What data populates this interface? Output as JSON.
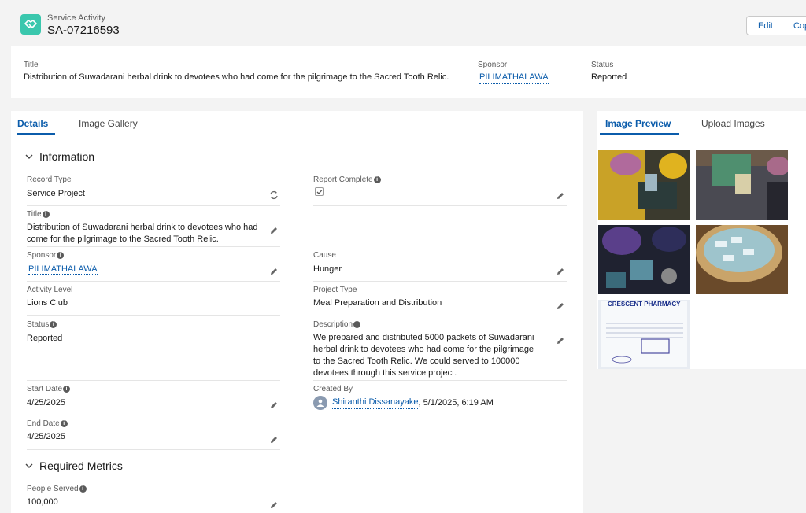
{
  "header": {
    "object_type": "Service Activity",
    "record_name": "SA-07216593",
    "buttons": {
      "edit": "Edit",
      "copy": "Cop"
    }
  },
  "highlights": {
    "title_label": "Title",
    "title_value": "Distribution of Suwadarani herbal drink to devotees who had come for the pilgrimage to the Sacred Tooth Relic.",
    "sponsor_label": "Sponsor",
    "sponsor_value": "PILIMATHALAWA",
    "status_label": "Status",
    "status_value": "Reported"
  },
  "tabs": {
    "details": "Details",
    "gallery": "Image Gallery"
  },
  "sections": {
    "information": "Information",
    "metrics": "Required Metrics"
  },
  "fields": {
    "record_type": {
      "label": "Record Type",
      "value": "Service Project"
    },
    "report_complete": {
      "label": "Report Complete",
      "checked": true
    },
    "title": {
      "label": "Title",
      "value": "Distribution of Suwadarani herbal drink to devotees who had come for the pilgrimage to the Sacred Tooth Relic."
    },
    "sponsor": {
      "label": "Sponsor",
      "value": "PILIMATHALAWA"
    },
    "cause": {
      "label": "Cause",
      "value": "Hunger"
    },
    "activity_level": {
      "label": "Activity Level",
      "value": "Lions Club"
    },
    "project_type": {
      "label": "Project Type",
      "value": "Meal Preparation and Distribution"
    },
    "status": {
      "label": "Status",
      "value": "Reported"
    },
    "description": {
      "label": "Description",
      "value": "We prepared and distributed 5000 packets of Suwadarani herbal drink to devotees who had come for the pilgrimage to the Sacred Tooth Relic. We could served to 100000 devotees through this service project."
    },
    "start_date": {
      "label": "Start Date",
      "value": "4/25/2025"
    },
    "created_by": {
      "label": "Created By",
      "user": "Shiranthi Dissanayake",
      "timestamp": ", 5/1/2025, 6:19 AM"
    },
    "end_date": {
      "label": "End Date",
      "value": "4/25/2025"
    },
    "people_served": {
      "label": "People Served",
      "value": "100,000"
    }
  },
  "side": {
    "tabs": {
      "preview": "Image Preview",
      "upload": "Upload Images"
    },
    "receipt_header": "CRESCENT PHARMACY"
  },
  "colors": {
    "brand": "#0b5cab",
    "icon_bg": "#3ac7ad"
  }
}
